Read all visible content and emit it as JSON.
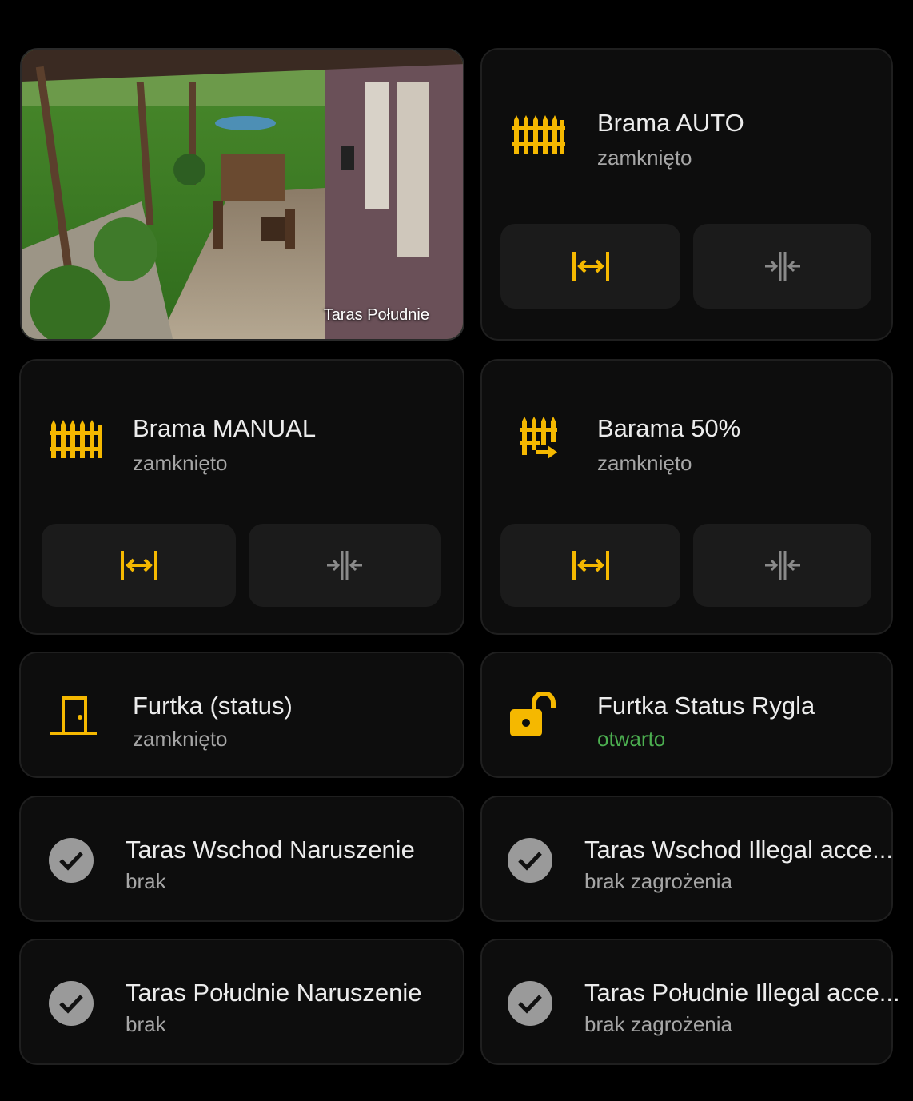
{
  "colors": {
    "accent": "#F5B800",
    "ok": "#4CAF50",
    "muted": "#A6A6A6"
  },
  "camera": {
    "label": "Taras Południe"
  },
  "cards": {
    "brama_auto": {
      "title": "Brama AUTO",
      "state": "zamknięto",
      "icon": "fence-icon"
    },
    "brama_manual": {
      "title": "Brama MANUAL",
      "state": "zamknięto",
      "icon": "fence-icon"
    },
    "barama_50": {
      "title": "Barama 50%",
      "state": "zamknięto",
      "icon": "fence-arrow-icon"
    },
    "furtka_status": {
      "title": "Furtka (status)",
      "state": "zamknięto",
      "icon": "door-icon"
    },
    "furtka_rygiel": {
      "title": "Furtka Status Rygla",
      "state": "otwarto",
      "icon": "lock-open-icon"
    },
    "taras_wschod_naruszenie": {
      "title": "Taras Wschod Naruszenie",
      "state": "brak",
      "icon": "check-circle-icon"
    },
    "taras_wschod_illegal": {
      "title": "Taras Wschod Illegal acce...",
      "state": "brak zagrożenia",
      "icon": "check-circle-icon"
    },
    "taras_poludnie_naruszenie": {
      "title": "Taras Południe Naruszenie",
      "state": "brak",
      "icon": "check-circle-icon"
    },
    "taras_poludnie_illegal": {
      "title": "Taras Południe Illegal acce...",
      "state": "brak zagrożenia",
      "icon": "check-circle-icon"
    }
  },
  "buttons": {
    "open": "arrow-expand-horizontal-icon",
    "close": "arrow-collapse-horizontal-icon"
  }
}
